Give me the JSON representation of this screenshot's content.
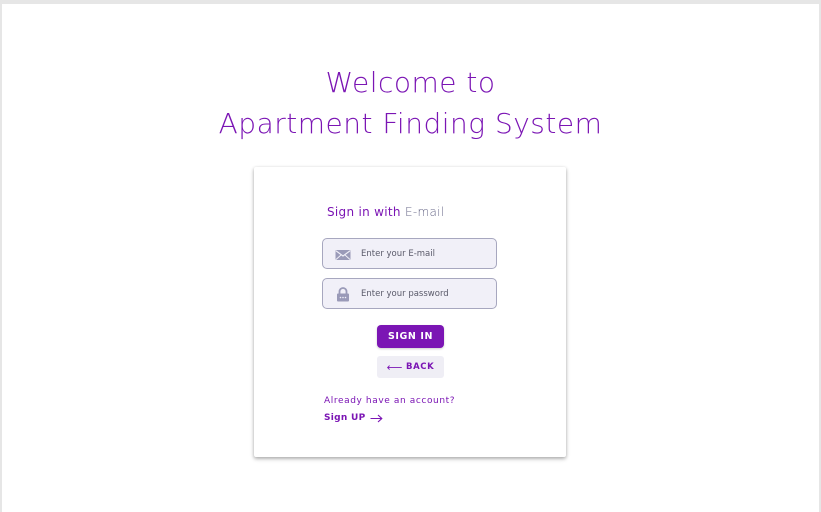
{
  "header": {
    "title_line1": "Welcome to",
    "title_line2": "Apartment Finding System"
  },
  "login_card": {
    "heading_prefix": "Sign in with",
    "heading_suffix": "E-mail",
    "email_field": {
      "placeholder": "Enter your E-mail",
      "value": "",
      "icon": "envelope-icon"
    },
    "password_field": {
      "placeholder": "Enter your password",
      "value": "",
      "icon": "lock-icon"
    },
    "sign_in_label": "SIGN IN",
    "back_label": "BACK",
    "back_icon": "arrow-left-icon",
    "account_prompt": "Already have an account?",
    "sign_up_label": "Sign UP",
    "sign_up_icon": "arrow-right-icon"
  },
  "colors": {
    "accent": "#7b15b4",
    "field_bg": "#f1f0f8",
    "field_border": "#a7a7bf",
    "icon": "#9a9ab8"
  }
}
